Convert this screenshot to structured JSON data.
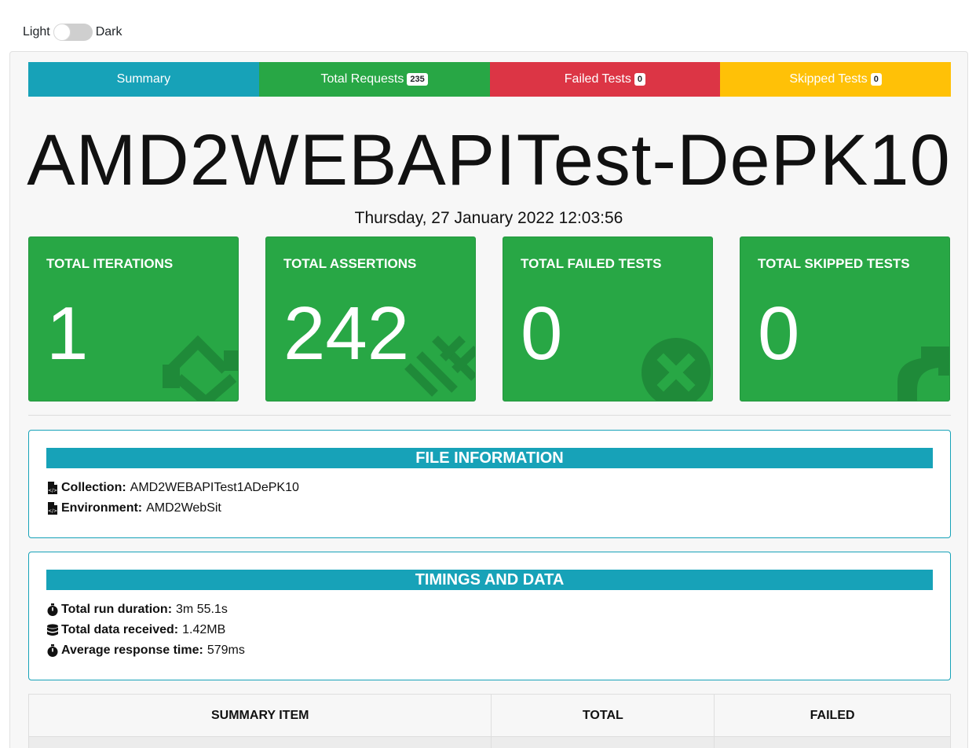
{
  "theme": {
    "light_label": "Light",
    "dark_label": "Dark"
  },
  "tabs": [
    {
      "label": "Summary",
      "badge": null,
      "color": "#17a2b8"
    },
    {
      "label": "Total Requests",
      "badge": "235",
      "color": "#28a745"
    },
    {
      "label": "Failed Tests",
      "badge": "0",
      "color": "#dc3545"
    },
    {
      "label": "Skipped Tests",
      "badge": "0",
      "color": "#ffc107"
    }
  ],
  "title": "AMD2WEBAPITest-DePK10",
  "timestamp": "Thursday, 27 January 2022 12:03:56",
  "stats": [
    {
      "label": "TOTAL ITERATIONS",
      "value": "1",
      "icon": "sync-icon"
    },
    {
      "label": "TOTAL ASSERTIONS",
      "value": "242",
      "icon": "list-icon"
    },
    {
      "label": "TOTAL FAILED TESTS",
      "value": "0",
      "icon": "times-circle-icon"
    },
    {
      "label": "TOTAL SKIPPED TESTS",
      "value": "0",
      "icon": "share-icon"
    }
  ],
  "file_info": {
    "header": "FILE INFORMATION",
    "collection_label": "Collection:",
    "collection_value": "AMD2WEBAPITest1ADePK10",
    "environment_label": "Environment:",
    "environment_value": "AMD2WebSit"
  },
  "timings": {
    "header": "TIMINGS AND DATA",
    "duration_label": "Total run duration:",
    "duration_value": "3m 55.1s",
    "data_label": "Total data received:",
    "data_value": "1.42MB",
    "response_label": "Average response time:",
    "response_value": "579ms"
  },
  "summary_table": {
    "headers": [
      "SUMMARY ITEM",
      "TOTAL",
      "FAILED"
    ]
  },
  "colors": {
    "info": "#17a2b8",
    "success": "#28a745",
    "danger": "#dc3545",
    "warning": "#ffc107"
  }
}
